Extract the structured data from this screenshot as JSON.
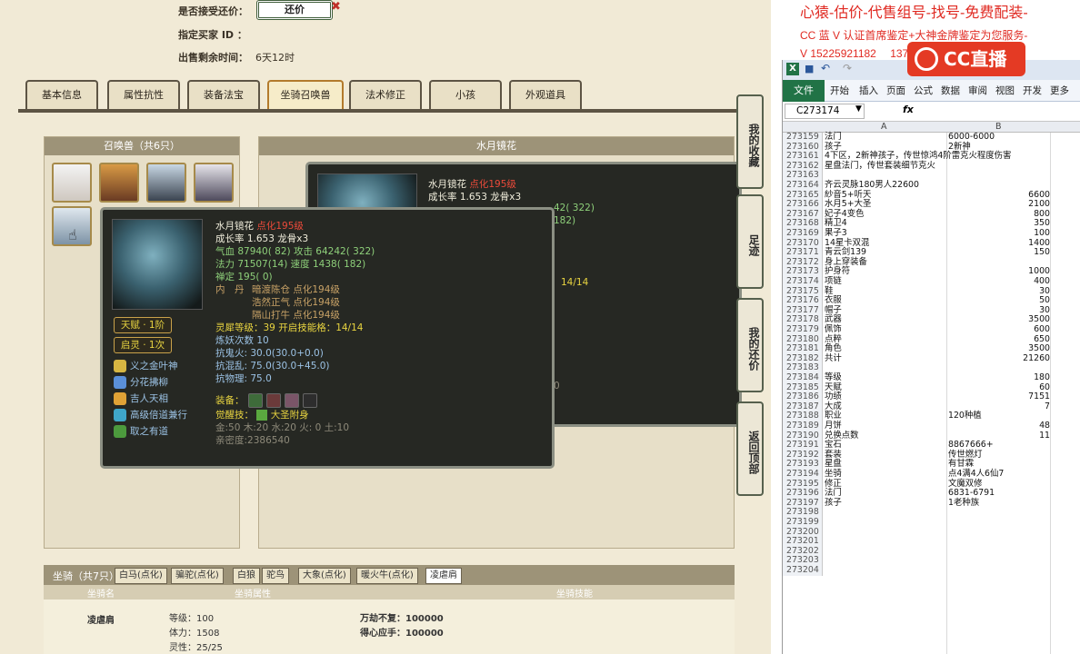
{
  "top_info": {
    "accept_counter_label": "是否接受还价：",
    "counter_button": "还价",
    "designated_buyer_label": "指定买家 ID ：",
    "remaining_label": "出售剩余时间：",
    "remaining_value": "6天12时"
  },
  "tabs": [
    "基本信息",
    "属性抗性",
    "装备法宝",
    "坐骑召唤兽",
    "法术修正",
    "小孩",
    "外观道具"
  ],
  "active_tab": "坐骑召唤兽",
  "pet_panel_title": "召唤兽（共6只）",
  "detail_panel_title": "水月镜花",
  "bg_window": {
    "name": "水月镜花",
    "rank": "点化195级",
    "growth": "成长率 1.653 龙骨x3",
    "frag1": "42( 322)",
    "frag2": "182)",
    "frag3": "14/14",
    "frag4": "0"
  },
  "tooltip": {
    "name": "水月镜花",
    "rank": "点化195级",
    "growth": "成长率 1.653 龙骨x3",
    "hp": "气血 87940( 82) 攻击 64242( 322)",
    "mp": "法力 71507(14) 速度 1438( 182)",
    "zen": "禅定 195( 0)",
    "neidan_label": "内　丹",
    "neidan": [
      "暗渡陈仓 点化194级",
      "浩然正气 点化194级",
      "隔山打牛 点化194级"
    ],
    "spirit": "灵犀等级：39 开启技能格：14/14",
    "refine": "炼妖次数 10",
    "res1": "抗鬼火: 30.0(30.0+0.0)",
    "res2": "抗混乱: 75.0(30.0+45.0)",
    "res3": "抗物理: 75.0",
    "equip_label": "装备：",
    "awaken_label": "觉醒技：",
    "awaken_skill": "大圣附身",
    "elements": "金:50 木:20 水:20 火: 0 土:10",
    "intimacy": "亲密度:2386540",
    "talent": "天赋 · 1阶",
    "spirit_tag": "启灵 · 1次",
    "skills": [
      {
        "name": "义之金叶神",
        "color": "#d7b642"
      },
      {
        "name": "分花拂柳",
        "color": "#5a8fd8"
      },
      {
        "name": "吉人天相",
        "color": "#e0a236"
      },
      {
        "name": "高级倍道兼行",
        "color": "#3fa6c9"
      },
      {
        "name": "取之有道",
        "color": "#4c9a3d"
      }
    ]
  },
  "side_buttons": [
    "我的收藏",
    "足迹",
    "我的还价",
    "返回顶部"
  ],
  "mount": {
    "title": "坐骑（共7只）",
    "tabs": [
      "白马(点化)",
      "骗驼(点化)",
      "白狼",
      "驼鸟",
      "大象(点化)",
      "暖火牛(点化)",
      "凌虐肩"
    ],
    "active": "凌虐肩",
    "col_name": "坐骑名",
    "col_attr": "坐骑属性",
    "col_skill": "坐骑技能",
    "name": "凌虐肩",
    "level": "等级：100",
    "stamina": "体力：1508",
    "spirit": "灵性：25/25",
    "skill1": "万劫不复：100000",
    "skill2": "得心应手：100000"
  },
  "promo": {
    "line1": "心猿-估价-代售组号-找号-免费配装-",
    "line2": "CC 蓝 V 认证首席鉴定+大神金牌鉴定为您服务-",
    "line3": "V 15225921182　 1372553376　手机号加 V",
    "logo": "CC直播"
  },
  "excel": {
    "ribbon_tabs": [
      "文件",
      "开始",
      "插入",
      "页面",
      "公式",
      "数据",
      "审阅",
      "视图",
      "开发",
      "更多"
    ],
    "name_box": "C273174",
    "fx": "fx",
    "col_a": "A",
    "col_b": "B",
    "rows": [
      {
        "n": "273159",
        "a": "法门",
        "b": "6000-6000",
        "num": false
      },
      {
        "n": "273160",
        "a": "孩子",
        "b": "2新神",
        "num": false
      },
      {
        "n": "273161",
        "a": "4下区，2新神孩子，传世惊鸿4阶雷克火程度伤害",
        "b": "",
        "num": false
      },
      {
        "n": "273162",
        "a": "星盘法门，传世套装细节克火",
        "b": "",
        "num": false
      },
      {
        "n": "273163",
        "a": "",
        "b": "",
        "num": false
      },
      {
        "n": "273164",
        "a": "齐云灵脉180男人22600",
        "b": "",
        "num": false
      },
      {
        "n": "273165",
        "a": "紗音5+听天",
        "b": "6600",
        "num": true
      },
      {
        "n": "273166",
        "a": "水月5+大圣",
        "b": "2100",
        "num": true
      },
      {
        "n": "273167",
        "a": "妃子4变色",
        "b": "800",
        "num": true
      },
      {
        "n": "273168",
        "a": "精卫4",
        "b": "350",
        "num": true
      },
      {
        "n": "273169",
        "a": "果子3",
        "b": "100",
        "num": true
      },
      {
        "n": "273170",
        "a": "14星卡双混",
        "b": "1400",
        "num": true
      },
      {
        "n": "273171",
        "a": "青云剑139",
        "b": "150",
        "num": true
      },
      {
        "n": "273172",
        "a": "身上穿装备",
        "b": "",
        "num": false
      },
      {
        "n": "273173",
        "a": "护身符",
        "b": "1000",
        "num": true
      },
      {
        "n": "273174",
        "a": "项链",
        "b": "400",
        "num": true
      },
      {
        "n": "273175",
        "a": "鞋",
        "b": "30",
        "num": true
      },
      {
        "n": "273176",
        "a": "衣服",
        "b": "50",
        "num": true
      },
      {
        "n": "273177",
        "a": "帽子",
        "b": "30",
        "num": true
      },
      {
        "n": "273178",
        "a": "武器",
        "b": "3500",
        "num": true
      },
      {
        "n": "273179",
        "a": "佩饰",
        "b": "600",
        "num": true
      },
      {
        "n": "273180",
        "a": "点粹",
        "b": "650",
        "num": true
      },
      {
        "n": "273181",
        "a": "角色",
        "b": "3500",
        "num": true
      },
      {
        "n": "273182",
        "a": "共计",
        "b": "21260",
        "num": true
      },
      {
        "n": "273183",
        "a": "",
        "b": "",
        "num": false
      },
      {
        "n": "273184",
        "a": "等级",
        "b": "180",
        "num": true
      },
      {
        "n": "273185",
        "a": "天赋",
        "b": "60",
        "num": true
      },
      {
        "n": "273186",
        "a": "功绩",
        "b": "7151",
        "num": true
      },
      {
        "n": "273187",
        "a": "大成",
        "b": "7",
        "num": true
      },
      {
        "n": "273188",
        "a": "职业",
        "b": "120种植",
        "num": false
      },
      {
        "n": "273189",
        "a": "月饼",
        "b": "48",
        "num": true
      },
      {
        "n": "273190",
        "a": "兑换点数",
        "b": "11",
        "num": true
      },
      {
        "n": "273191",
        "a": "宝石",
        "b": "8867666+",
        "num": false
      },
      {
        "n": "273192",
        "a": "套装",
        "b": "传世燃灯",
        "num": false
      },
      {
        "n": "273193",
        "a": "星盘",
        "b": "有甘霖",
        "num": false
      },
      {
        "n": "273194",
        "a": "坐骑",
        "b": "点4满4人6仙7",
        "num": false
      },
      {
        "n": "273195",
        "a": "修正",
        "b": "文魔双修",
        "num": false
      },
      {
        "n": "273196",
        "a": "法门",
        "b": "6831-6791",
        "num": false
      },
      {
        "n": "273197",
        "a": "孩子",
        "b": "1老种族",
        "num": false
      },
      {
        "n": "273198",
        "a": "",
        "b": "",
        "num": false
      },
      {
        "n": "273199",
        "a": "",
        "b": "",
        "num": false
      },
      {
        "n": "273200",
        "a": "",
        "b": "",
        "num": false
      },
      {
        "n": "273201",
        "a": "",
        "b": "",
        "num": false
      },
      {
        "n": "273202",
        "a": "",
        "b": "",
        "num": false
      },
      {
        "n": "273203",
        "a": "",
        "b": "",
        "num": false
      },
      {
        "n": "273204",
        "a": "",
        "b": "",
        "num": false
      }
    ]
  }
}
